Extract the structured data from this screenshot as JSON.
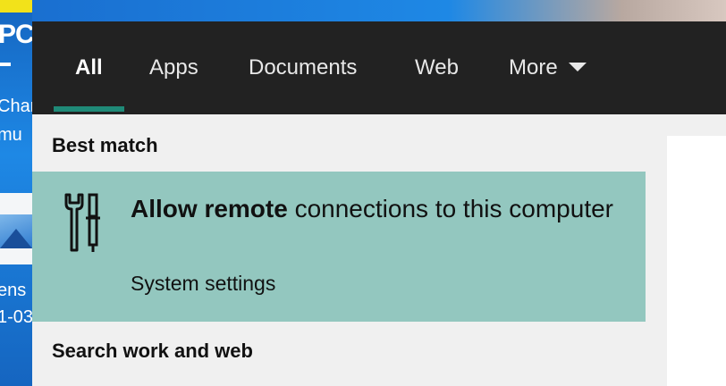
{
  "desktop": {
    "pc_label": "PC",
    "text_lines": [
      "Char",
      "mu",
      "ens",
      "1-03"
    ]
  },
  "search": {
    "tabs": [
      {
        "label": "All",
        "active": true
      },
      {
        "label": "Apps"
      },
      {
        "label": "Documents"
      },
      {
        "label": "Web"
      },
      {
        "label": "More"
      }
    ],
    "best_match_header": "Best match",
    "result": {
      "title_bold": "Allow remote",
      "title_rest": " connections to this computer",
      "subtitle": "System settings",
      "icon": "settings-tools-icon"
    },
    "search_web_header": "Search work and web"
  },
  "colors": {
    "topbar": "#222222",
    "accent_underline": "#1f8a78",
    "result_highlight": "#93c7bf",
    "panel_bg": "#f0f0f0"
  }
}
